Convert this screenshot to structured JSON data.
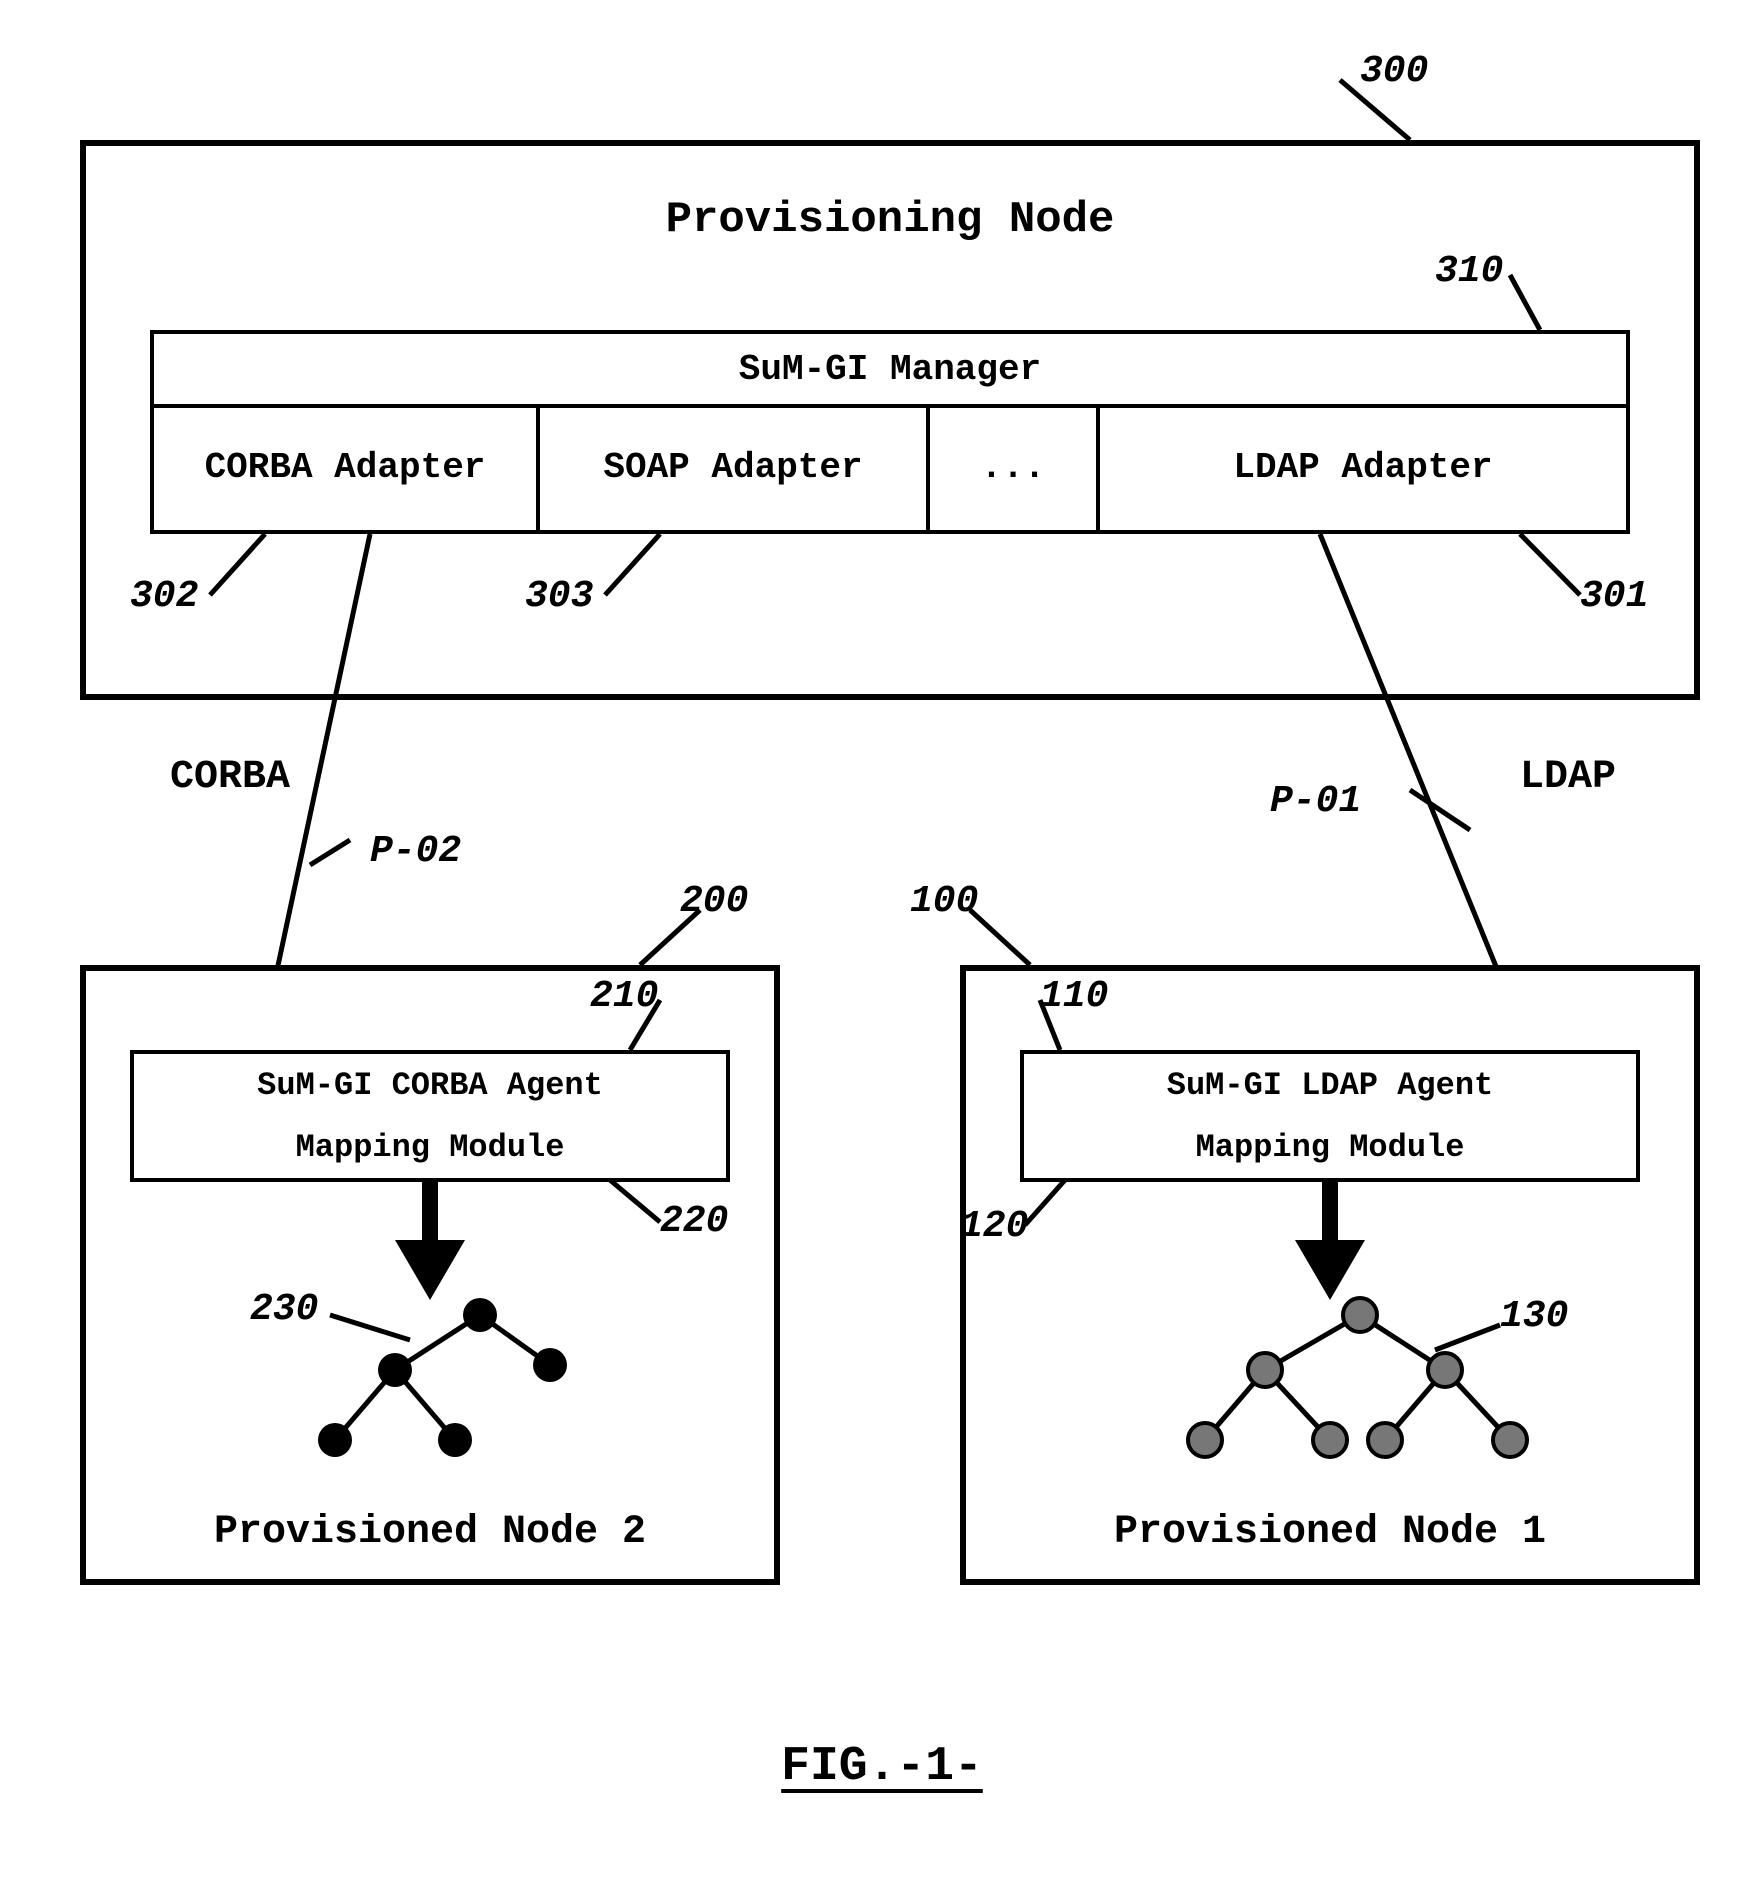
{
  "provisioning_node": {
    "title": "Provisioning Node",
    "ref_300": "300",
    "manager": {
      "label": "SuM-GI Manager",
      "ref_310": "310"
    },
    "adapters": {
      "corba": {
        "label": "CORBA Adapter",
        "ref": "302"
      },
      "soap": {
        "label": "SOAP Adapter",
        "ref": "303"
      },
      "ellipsis": "...",
      "ldap": {
        "label": "LDAP Adapter",
        "ref": "301"
      }
    }
  },
  "links": {
    "corba": {
      "label": "CORBA",
      "ref": "P-02"
    },
    "ldap": {
      "label": "LDAP",
      "ref": "P-01"
    }
  },
  "node2": {
    "title": "Provisioned Node 2",
    "ref_200": "200",
    "agent": {
      "label": "SuM-GI CORBA Agent",
      "ref": "210"
    },
    "mapping": {
      "label": "Mapping Module",
      "ref": "220"
    },
    "tree_ref": "230"
  },
  "node1": {
    "title": "Provisioned Node 1",
    "ref_100": "100",
    "agent": {
      "label": "SuM-GI LDAP Agent",
      "ref": "110"
    },
    "mapping": {
      "label": "Mapping Module",
      "ref": "120"
    },
    "tree_ref": "130"
  },
  "figure_label": "FIG.-1-"
}
